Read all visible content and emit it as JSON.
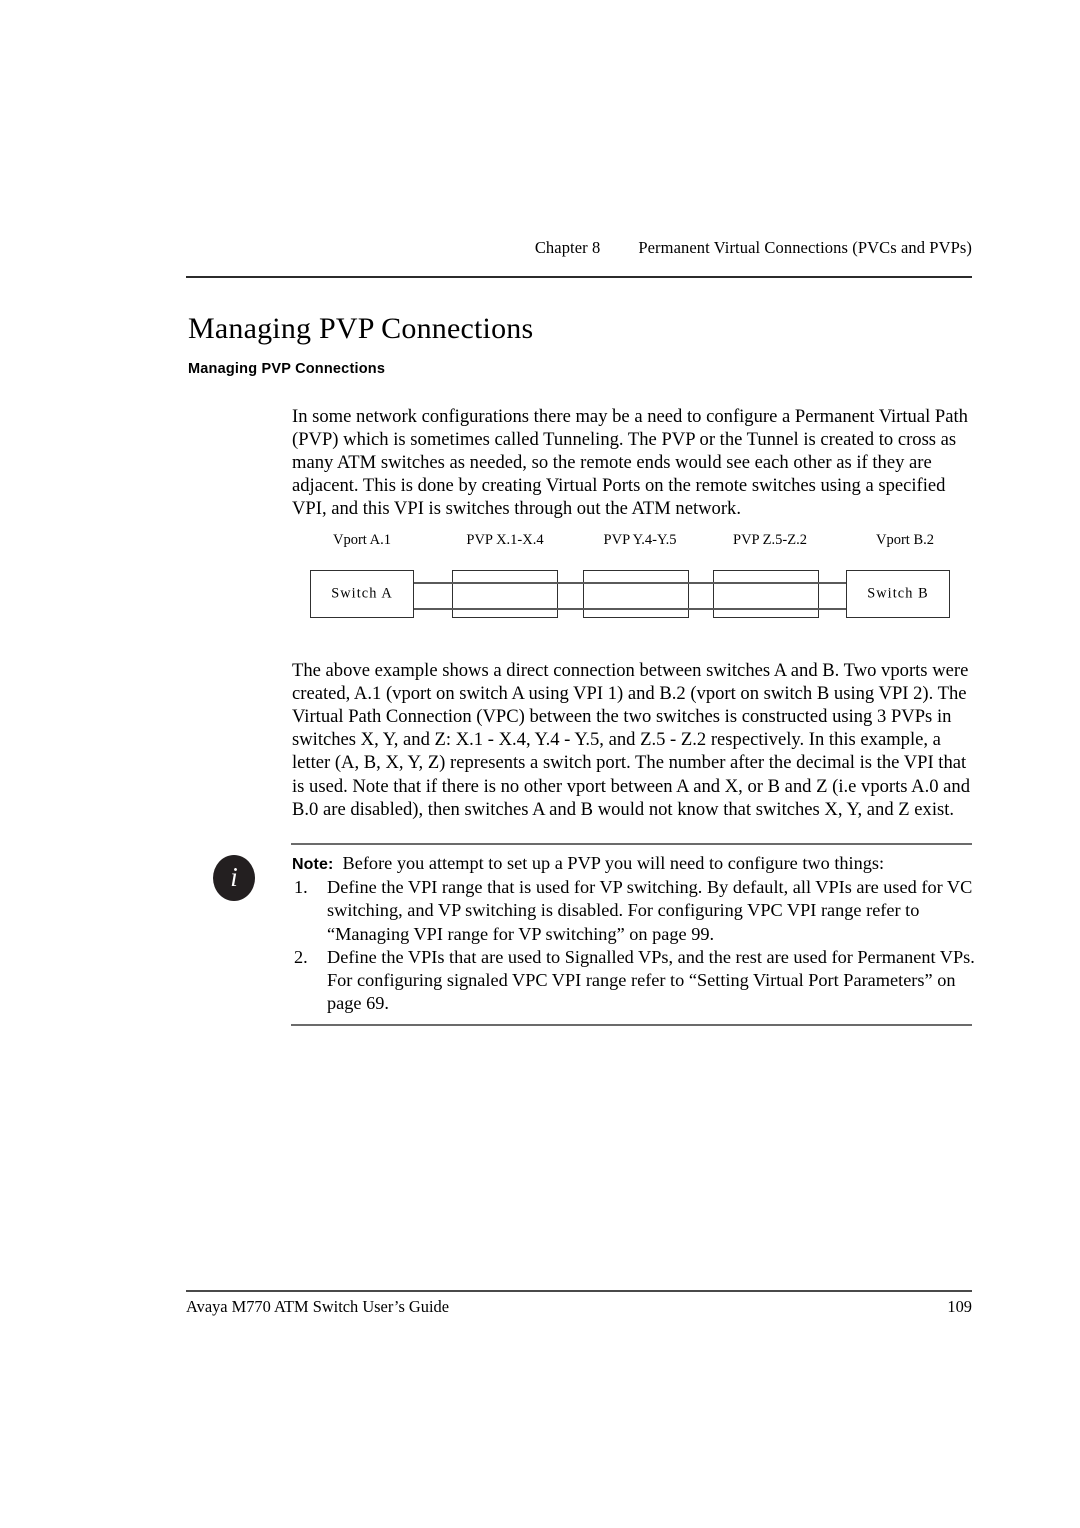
{
  "header": {
    "chapter_label": "Chapter 8",
    "chapter_title": "Permanent Virtual Connections (PVCs and PVPs)"
  },
  "page_title": "Managing PVP Connections",
  "sub_heading": "Managing PVP Connections",
  "paragraphs": {
    "intro": "In some network configurations there may be a need to configure a Permanent Virtual Path (PVP) which is sometimes called Tunneling. The PVP or the Tunnel is created to cross as many ATM switches as needed, so the remote ends would see each other as if they are adjacent. This is done by creating Virtual Ports on the remote switches using a specified VPI, and this VPI is switches through out the ATM network.",
    "explanation": "The above example shows a direct connection between switches A and B. Two vports were created, A.1 (vport on switch A using VPI 1) and B.2 (vport on switch B using VPI 2). The Virtual Path Connection (VPC) between the two switches is constructed using 3 PVPs in switches X, Y, and Z: X.1 - X.4, Y.4 - Y.5, and Z.5 - Z.2 respectively. In this example, a letter (A, B, X, Y, Z) represents a switch port. The number after the decimal is the VPI that is used. Note that if there is no other vport between A and X, or B and Z (i.e vports A.0 and B.0 are disabled), then switches A and B would not know that switches X, Y, and Z exist."
  },
  "diagram": {
    "labels": [
      "Vport A.1",
      "PVP X.1-X.4",
      "PVP Y.4-Y.5",
      "PVP Z.5-Z.2",
      "Vport B.2"
    ],
    "boxes": [
      {
        "text": "Switch A"
      },
      {
        "text": ""
      },
      {
        "text": ""
      },
      {
        "text": ""
      },
      {
        "text": "Switch B"
      }
    ],
    "line_color": "#5a5a5a",
    "border_color": "#303030"
  },
  "note": {
    "keyword": "Note:",
    "lead": "Before you attempt to set up a PVP you will need to configure two things:",
    "icon": "info-icon",
    "items": [
      {
        "marker": "1.",
        "text": "Define the VPI range that is used for VP switching. By default, all VPIs are used for VC switching, and VP switching is disabled. For configuring VPC VPI range refer to “Managing VPI range for VP switching” on page 99."
      },
      {
        "marker": "2.",
        "text": "Define the VPIs that are used to Signalled VPs, and the rest are used for Permanent VPs. For configuring signaled VPC VPI range refer to “Setting Virtual Port Parameters” on page 69."
      }
    ]
  },
  "footer": {
    "doc_title": "Avaya M770 ATM Switch User’s Guide",
    "page_number": "109"
  }
}
